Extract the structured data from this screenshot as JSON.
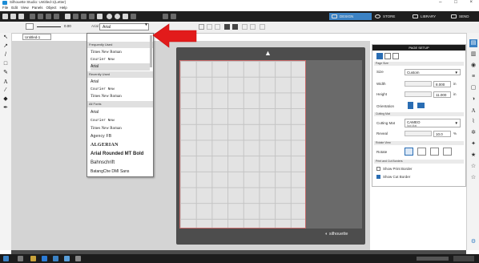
{
  "window": {
    "title": "Silhouette Studio: Untitled-1(Letter)",
    "controls": [
      "–",
      "□",
      "×"
    ]
  },
  "menu": [
    "File",
    "Edit",
    "View",
    "Panels",
    "Object",
    "Help"
  ],
  "tabs": [
    {
      "label": "DESIGN",
      "active": true
    },
    {
      "label": "STORE",
      "active": false
    },
    {
      "label": "LIBRARY",
      "active": false
    },
    {
      "label": "SEND",
      "active": false
    }
  ],
  "toolbar2": {
    "line_value": "0.00",
    "font_label": "Arial",
    "font_value": "Arial"
  },
  "document": {
    "tab_label": "Untitled-1",
    "brand": "silhouette"
  },
  "font_dropdown": {
    "sections": [
      {
        "header": "Frequently Used",
        "items": [
          "Times New Roman",
          "Courier New",
          "Arial"
        ]
      },
      {
        "header": "Recently Used",
        "items": [
          "Arial",
          "Courier New",
          "Times New Roman"
        ]
      },
      {
        "header": "All Fonts",
        "items": [
          "Arial",
          "Courier New",
          "Times New Roman",
          "Agency FB",
          "ALGERIAN",
          "Arial Rounded MT Bold",
          "Bahnschrift",
          "BatangChe DMI Sans"
        ]
      }
    ],
    "selected": "Arial"
  },
  "page_setup": {
    "title": "PAGE SETUP",
    "media_section": "Page Size",
    "size_label": "Size",
    "size_value": "Custom",
    "width_label": "Width",
    "width_value": "8.000",
    "height_label": "Height",
    "height_value": "11.000",
    "units": "in",
    "orientation_label": "Orientation",
    "cutting_mat_section": "Cutting Mat",
    "cutting_mat_label": "Cutting Mat",
    "cutting_mat_value": "CAMEO",
    "cutting_mat_sub": "Not Mat",
    "reveal_label": "Reveal",
    "reveal_value": "10.0",
    "reveal_unit": "%",
    "rotate_section": "Rotate View",
    "rotate_label": "Rotate",
    "border_section": "Print and Cut Borders",
    "show_print_border": "Show Print Border",
    "show_cut_border": "Show Cut Border"
  },
  "colors": {
    "accent": "#3b82c4",
    "toolbar": "#1e1e1e",
    "arrow": "#e21b1b",
    "cut_border": "#c76a6a"
  },
  "icons": {
    "left": [
      "pointer-icon",
      "node-edit-icon",
      "line-icon",
      "rectangle-icon",
      "pencil-icon",
      "text-icon",
      "knife-icon",
      "eraser-icon",
      "pen-icon"
    ],
    "right": [
      "page-setup-icon",
      "library-icon",
      "fill-color-icon",
      "line-style-icon",
      "replicate-icon",
      "offset-icon",
      "text-style-icon",
      "trace-icon",
      "transform-icon",
      "modify-icon",
      "send-icon"
    ]
  }
}
